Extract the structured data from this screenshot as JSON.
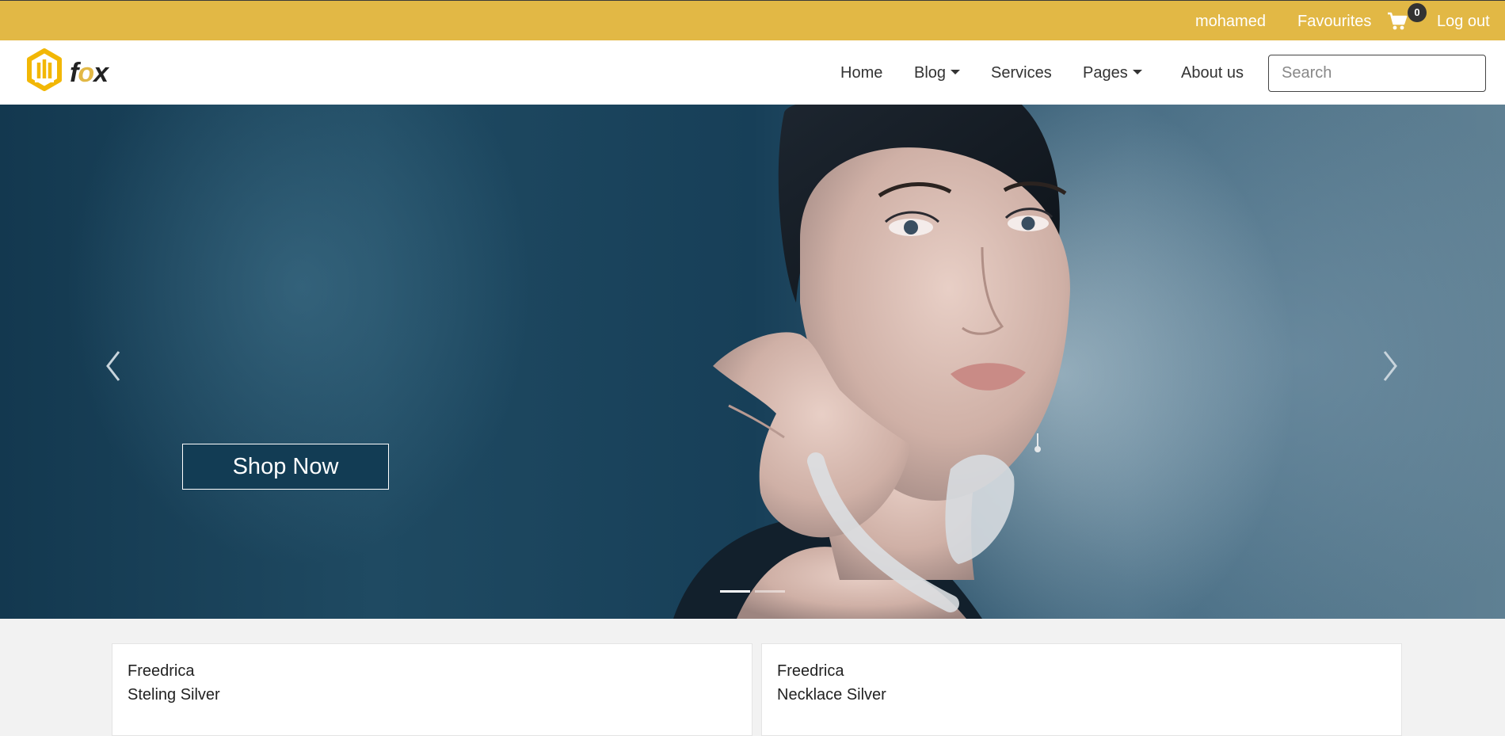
{
  "topbar": {
    "username": "mohamed",
    "favourites_label": "Favourites",
    "cart_count": "0",
    "logout_label": "Log out"
  },
  "navbar": {
    "brand": {
      "letter_f": "f",
      "letter_o": "o",
      "letter_x": "x"
    },
    "items": [
      {
        "label": "Home"
      },
      {
        "label": "Blog",
        "dropdown": true
      },
      {
        "label": "Services"
      },
      {
        "label": "Pages",
        "dropdown": true
      },
      {
        "label": "About us"
      }
    ],
    "search_placeholder": "Search"
  },
  "hero": {
    "cta_label": "Shop Now",
    "slide_count": 2,
    "active_slide": 1
  },
  "products": [
    {
      "name": "Freedrica",
      "description": "Steling Silver"
    },
    {
      "name": "Freedrica",
      "description": "Necklace Silver"
    }
  ],
  "colors": {
    "brand_yellow": "#e2b845",
    "hero_dark": "#123c54",
    "text_dark": "#333333"
  }
}
